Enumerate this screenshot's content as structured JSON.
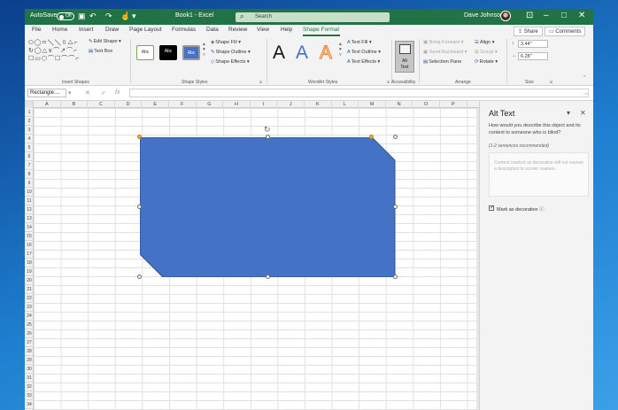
{
  "titlebar": {
    "autosave_label": "AutoSave",
    "autosave_state": "Off",
    "file_name": "Book1 - Excel",
    "search_placeholder": "Search",
    "user_name": "Dave Johnson"
  },
  "tabs": [
    "File",
    "Home",
    "Insert",
    "Draw",
    "Page Layout",
    "Formulas",
    "Data",
    "Review",
    "View",
    "Help",
    "Shape Format"
  ],
  "active_tab": "Shape Format",
  "share_label": "Share",
  "comments_label": "Comments",
  "ribbon": {
    "insert_shapes": {
      "edit_shape": "Edit Shape",
      "text_box": "Text Box",
      "group_label": "Insert Shapes"
    },
    "shape_styles": {
      "styles": [
        "Abc",
        "Abc",
        "Abc"
      ],
      "shape_fill": "Shape Fill",
      "shape_outline": "Shape Outline",
      "shape_effects": "Shape Effects",
      "group_label": "Shape Styles"
    },
    "wordart": {
      "samples": [
        "A",
        "A",
        "A"
      ],
      "text_fill": "Text Fill",
      "text_outline": "Text Outline",
      "text_effects": "Text Effects",
      "group_label": "WordArt Styles"
    },
    "accessibility": {
      "alt_line1": "Alt",
      "alt_line2": "Text",
      "group_label": "Accessibility"
    },
    "arrange": {
      "bring_forward": "Bring Forward",
      "send_backward": "Send Backward",
      "selection_pane": "Selection Pane",
      "align": "Align",
      "group": "Group",
      "rotate": "Rotate",
      "group_label": "Arrange"
    },
    "size": {
      "height": "3.44\"",
      "width": "6.28\"",
      "group_label": "Size"
    }
  },
  "formula_bar": {
    "name_box": "Rectangle:...",
    "fx": "fx"
  },
  "grid": {
    "columns": [
      "A",
      "B",
      "C",
      "D",
      "E",
      "F",
      "G",
      "H",
      "I",
      "J",
      "K",
      "L",
      "M",
      "N",
      "O",
      "P"
    ],
    "rows": [
      "1",
      "2",
      "3",
      "4",
      "5",
      "6",
      "7",
      "8",
      "9",
      "10",
      "11",
      "12",
      "13",
      "14",
      "15",
      "16",
      "17",
      "18",
      "19",
      "20",
      "21",
      "22",
      "23",
      "24",
      "25",
      "26",
      "27",
      "28",
      "29",
      "30",
      "31",
      "32",
      "33",
      "34"
    ]
  },
  "shape": {
    "fill_color": "#4472c4",
    "outline_color": "#2f528f"
  },
  "alt_text_pane": {
    "title": "Alt Text",
    "question": "How would you describe this object and its context to someone who is blind?",
    "hint": "(1-2 sentences recommended)",
    "placeholder": "Content marked as decorative will not expose a description to screen readers.",
    "checkbox_label": "Mark as decorative",
    "checked": true
  },
  "colors": {
    "excel_green": "#217346",
    "tab_bg": "#f3f3f3"
  }
}
